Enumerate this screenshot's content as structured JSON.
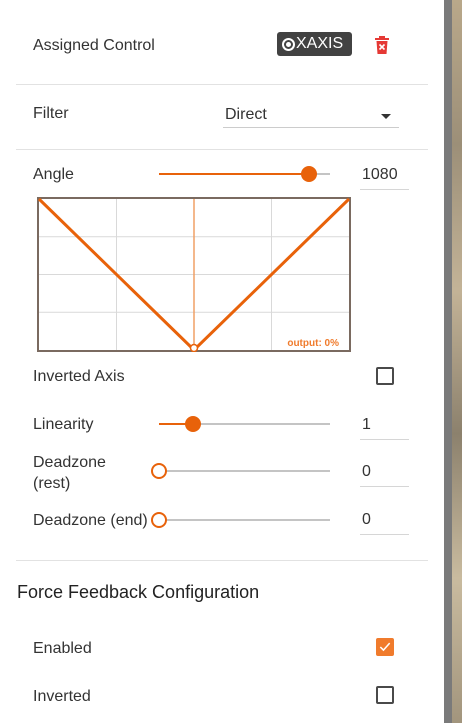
{
  "assigned": {
    "label": "Assigned Control",
    "badge": "XAXIS"
  },
  "filter": {
    "label": "Filter",
    "value": "Direct"
  },
  "angle": {
    "label": "Angle",
    "value": "1080",
    "slider_fraction": 0.88
  },
  "chart_data": {
    "type": "line",
    "x": [
      -1,
      0,
      1
    ],
    "y": [
      1,
      0,
      1
    ],
    "xlim": [
      -1,
      1
    ],
    "ylim": [
      0,
      1
    ],
    "grid": true,
    "current_x": 0,
    "annotation": "output: 0%"
  },
  "inverted_axis": {
    "label": "Inverted Axis",
    "checked": false
  },
  "linearity": {
    "label": "Linearity",
    "value": "1",
    "slider_fraction": 0.2
  },
  "deadzone_rest": {
    "label_line1": "Deadzone",
    "label_line2": "(rest)",
    "value": "0",
    "slider_fraction": 0
  },
  "deadzone_end": {
    "label": "Deadzone (end)",
    "value": "0",
    "slider_fraction": 0
  },
  "force_feedback": {
    "heading": "Force Feedback Configuration",
    "enabled": {
      "label": "Enabled",
      "checked": true
    },
    "inverted": {
      "label": "Inverted",
      "checked": false
    }
  },
  "colors": {
    "accent": "#e8620a",
    "badge_bg": "#424242",
    "delete": "#e53935",
    "checkbox_checked": "#f07b2c"
  }
}
